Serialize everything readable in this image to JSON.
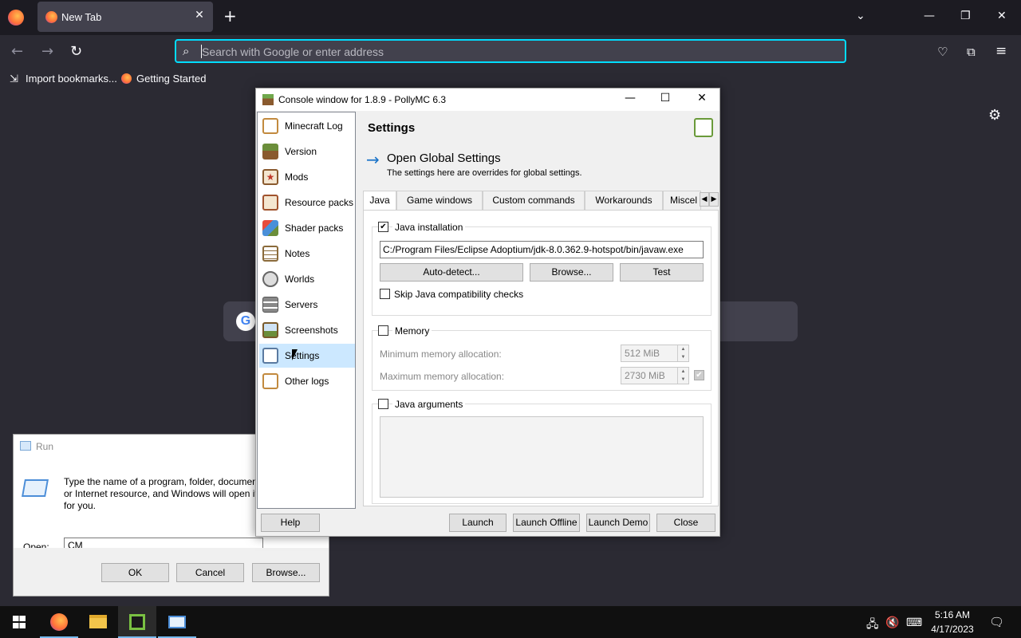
{
  "browser": {
    "tab_title": "New Tab",
    "tab_close": "✕",
    "new_tab": "+",
    "tab_list": "⌄",
    "url_placeholder": "Search with Google or enter address",
    "bookmarks": [
      "Import bookmarks...",
      "Getting Started"
    ]
  },
  "pollymc": {
    "title": "Console window for 1.8.9 - PollyMC 6.3",
    "sidebar": [
      {
        "label": "Minecraft Log",
        "icon": "book-icon",
        "color": "#c28a3e"
      },
      {
        "label": "Version",
        "icon": "grass-block-icon",
        "color": "#6b8e3a"
      },
      {
        "label": "Mods",
        "icon": "star-icon",
        "color": "#c0392b"
      },
      {
        "label": "Resource packs",
        "icon": "jar-icon",
        "color": "#a0522d"
      },
      {
        "label": "Shader packs",
        "icon": "cube-icon",
        "color": "#4a90d9"
      },
      {
        "label": "Notes",
        "icon": "notes-icon",
        "color": "#8a6a3a"
      },
      {
        "label": "Worlds",
        "icon": "globe-icon",
        "color": "#666666"
      },
      {
        "label": "Servers",
        "icon": "server-icon",
        "color": "#555555"
      },
      {
        "label": "Screenshots",
        "icon": "image-icon",
        "color": "#7a5a2a"
      },
      {
        "label": "Settings",
        "icon": "settings-list-icon",
        "color": "#5a7aa0"
      },
      {
        "label": "Other logs",
        "icon": "book-icon",
        "color": "#c28a3e"
      }
    ],
    "selected_index": 9,
    "main": {
      "title": "Settings",
      "global_link": "Open Global Settings",
      "global_sub": "The settings here are overrides for global settings.",
      "tabs": [
        "Java",
        "Game windows",
        "Custom commands",
        "Workarounds",
        "Miscel"
      ],
      "java_installation": {
        "label": "Java installation",
        "checked": true,
        "path": "C:/Program Files/Eclipse Adoptium/jdk-8.0.362.9-hotspot/bin/javaw.exe",
        "autodetect": "Auto-detect...",
        "browse": "Browse...",
        "test": "Test",
        "skip_label": "Skip Java compatibility checks"
      },
      "memory": {
        "label": "Memory",
        "min_label": "Minimum memory allocation:",
        "min_value": "512 MiB",
        "max_label": "Maximum memory allocation:",
        "max_value": "2730 MiB"
      },
      "java_args": {
        "label": "Java arguments"
      }
    },
    "footer": {
      "help": "Help",
      "launch": "Launch",
      "launch_offline": "Launch Offline",
      "launch_demo": "Launch Demo",
      "close": "Close"
    }
  },
  "run_dialog": {
    "title": "Run",
    "description": "Type the name of a program, folder, document, or Internet resource, and Windows will open it for you.",
    "open_label": "Open:",
    "open_value": "CM",
    "ok": "OK",
    "cancel": "Cancel",
    "browse": "Browse..."
  },
  "taskbar": {
    "time": "5:16 AM",
    "date": "4/17/2023"
  }
}
